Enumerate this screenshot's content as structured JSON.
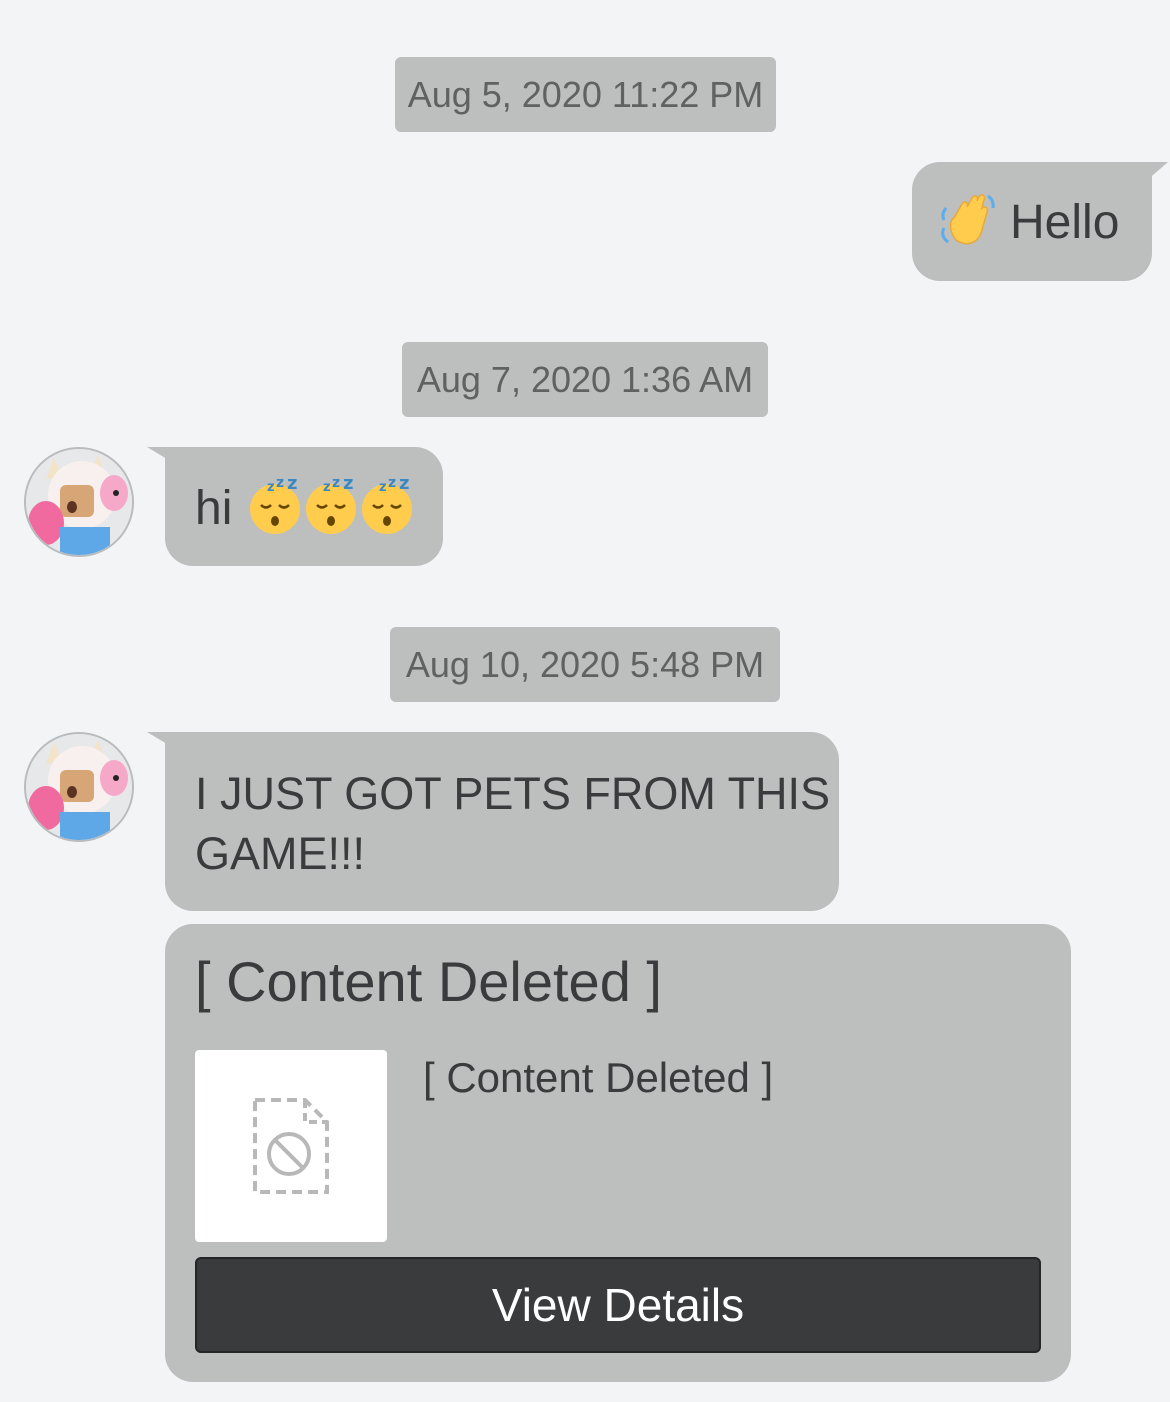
{
  "messages": {
    "ts1": "Aug 5, 2020 11:22 PM",
    "sent1": {
      "text": "Hello",
      "emoji_icon": "waving-hand-icon"
    },
    "ts2": "Aug 7, 2020 1:36 AM",
    "recv1": {
      "text": "hi",
      "emoji_icon": "sleeping-face-icon",
      "emoji_count": 3
    },
    "ts3": "Aug 10, 2020 5:48 PM",
    "recv2": {
      "text_line1": "I JUST GOT PETS FROM THIS",
      "text_line2": "GAME!!!"
    },
    "card": {
      "title": "[ Content Deleted ]",
      "subtitle": "[ Content Deleted ]",
      "thumbnail_icon": "deleted-content-icon",
      "button_label": "View Details"
    }
  },
  "colors": {
    "background": "#f2f4f5",
    "bubble": "#bdbebe",
    "button": "#393b3d",
    "text": "#393b3d"
  }
}
